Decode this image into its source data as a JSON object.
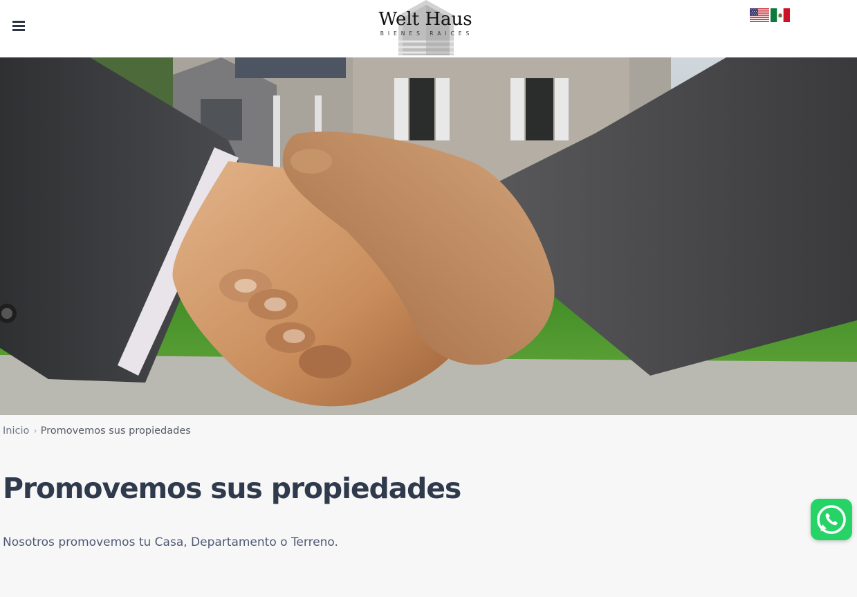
{
  "header": {
    "menu_icon": "hamburger-menu-icon",
    "logo": {
      "title": "Welt Haus",
      "subtitle": "BIENES RAICES"
    },
    "languages": [
      {
        "name": "English",
        "icon": "us-flag-icon"
      },
      {
        "name": "Español",
        "icon": "mx-flag-icon"
      }
    ]
  },
  "hero": {
    "description": "handshake-photo"
  },
  "breadcrumb": {
    "home": "Inicio",
    "separator_icon": "chevron-right-icon",
    "current": "Promovemos sus propiedades"
  },
  "main": {
    "title": "Promovemos sus propiedades",
    "text": "Nosotros promovemos tu Casa, Departamento o Terreno."
  },
  "whatsapp": {
    "icon": "whatsapp-icon",
    "color": "#25d366"
  },
  "colors": {
    "heading": "#2f3a4d",
    "body_text": "#4d5a75",
    "page_bg": "#f7f7f7"
  }
}
